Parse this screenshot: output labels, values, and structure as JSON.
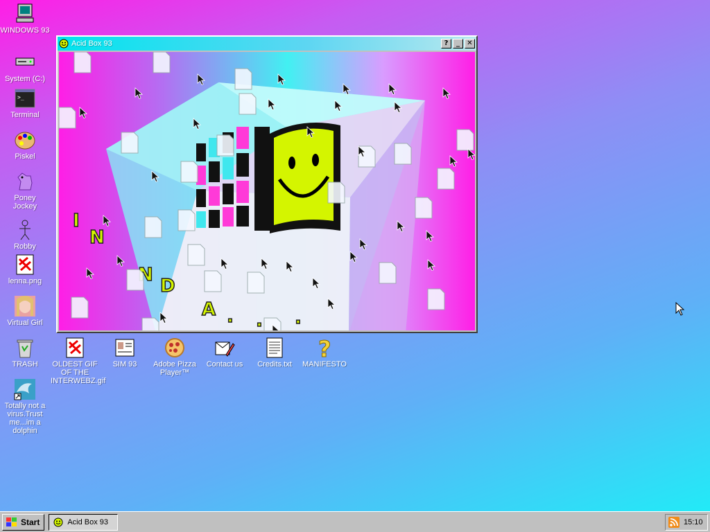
{
  "desktop": {
    "left_icons": [
      {
        "name": "windows93-icon",
        "label": "WINDOWS 93"
      },
      {
        "name": "system-drive-icon",
        "label": "System (C:)"
      },
      {
        "name": "terminal-icon",
        "label": "Terminal"
      },
      {
        "name": "piskel-icon",
        "label": "Piskel"
      },
      {
        "name": "poney-jockey-icon",
        "label": "Poney Jockey"
      },
      {
        "name": "robby-icon",
        "label": "Robby"
      },
      {
        "name": "image-file-icon",
        "label": "lenna.png"
      },
      {
        "name": "virtual-girl-icon",
        "label": "Virtual Girl"
      },
      {
        "name": "trash-icon",
        "label": "TRASH"
      },
      {
        "name": "dolphin-shortcut-icon",
        "label": "Totally not a virus.Trust me...im a dolphin"
      }
    ],
    "row_icons": [
      {
        "name": "gif-file-icon",
        "label": "OLDEST GIF OF THE INTERWEBZ.gif"
      },
      {
        "name": "sim93-icon",
        "label": "SIM 93"
      },
      {
        "name": "pizza-player-icon",
        "label": "Adobe Pizza Player™"
      },
      {
        "name": "contact-icon",
        "label": "Contact us"
      },
      {
        "name": "text-file-icon",
        "label": "Credits.txt"
      },
      {
        "name": "question-mark-icon",
        "label": "MANIFESTO"
      }
    ]
  },
  "window": {
    "title": "Acid Box 93",
    "help_label": "?",
    "minimize_label": "_",
    "close_label": "✕",
    "content_letters": [
      "I",
      "N",
      "N",
      "D",
      "A",
      ".",
      ".",
      "."
    ]
  },
  "taskbar": {
    "start_label": "Start",
    "task_label": "Acid Box 93",
    "clock": "15:10"
  },
  "colors": {
    "accent_cyan": "#00e4ee",
    "magenta": "#ff1ee6",
    "smiley_yellow": "#d4f500"
  }
}
